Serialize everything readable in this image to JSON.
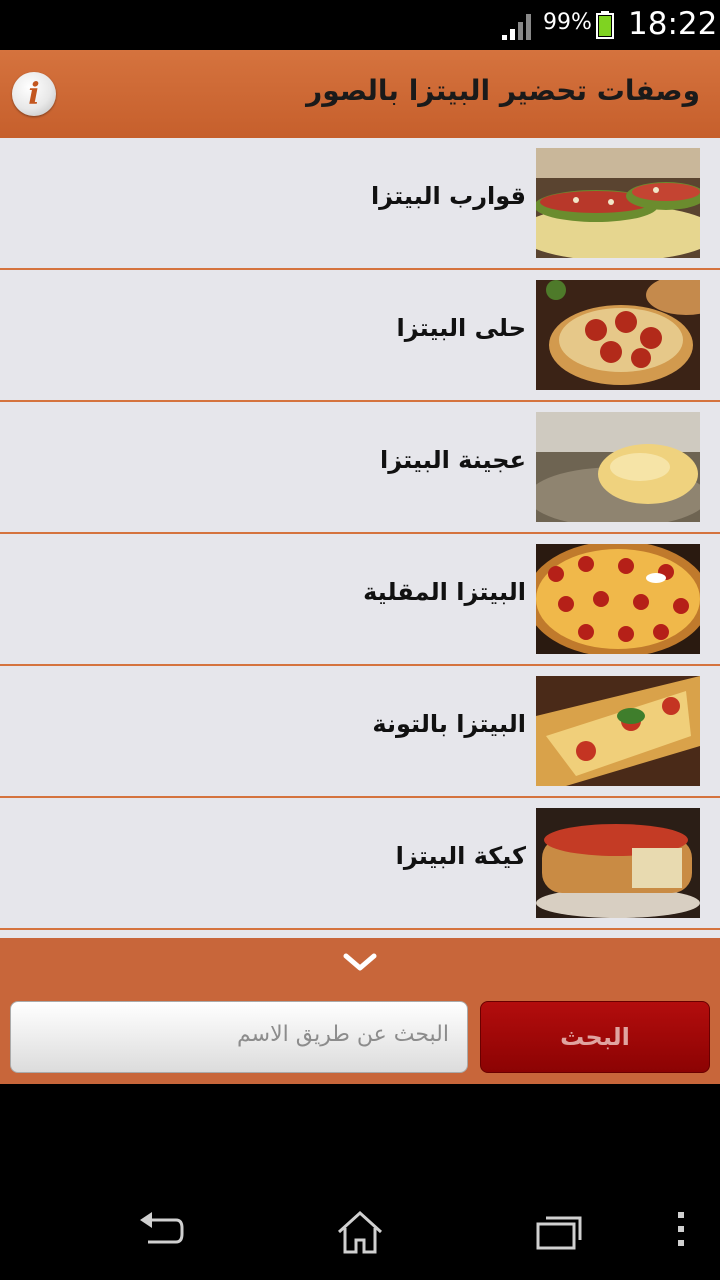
{
  "status": {
    "battery": "99%",
    "time": "18:22"
  },
  "app": {
    "title": "وصفات تحضير البيتزا بالصور"
  },
  "items": [
    {
      "label": "قوارب البيتزا"
    },
    {
      "label": "حلى البيتزا"
    },
    {
      "label": "عجينة البيتزا"
    },
    {
      "label": "البيتزا المقلية"
    },
    {
      "label": "البيتزا بالتونة"
    },
    {
      "label": "كيكة البيتزا"
    }
  ],
  "search": {
    "placeholder": "البحث عن طريق الاسم",
    "button_label": "البحث"
  },
  "colors": {
    "accent": "#c8663a",
    "search_button": "#a00808",
    "list_bg": "#e6e6eb"
  }
}
